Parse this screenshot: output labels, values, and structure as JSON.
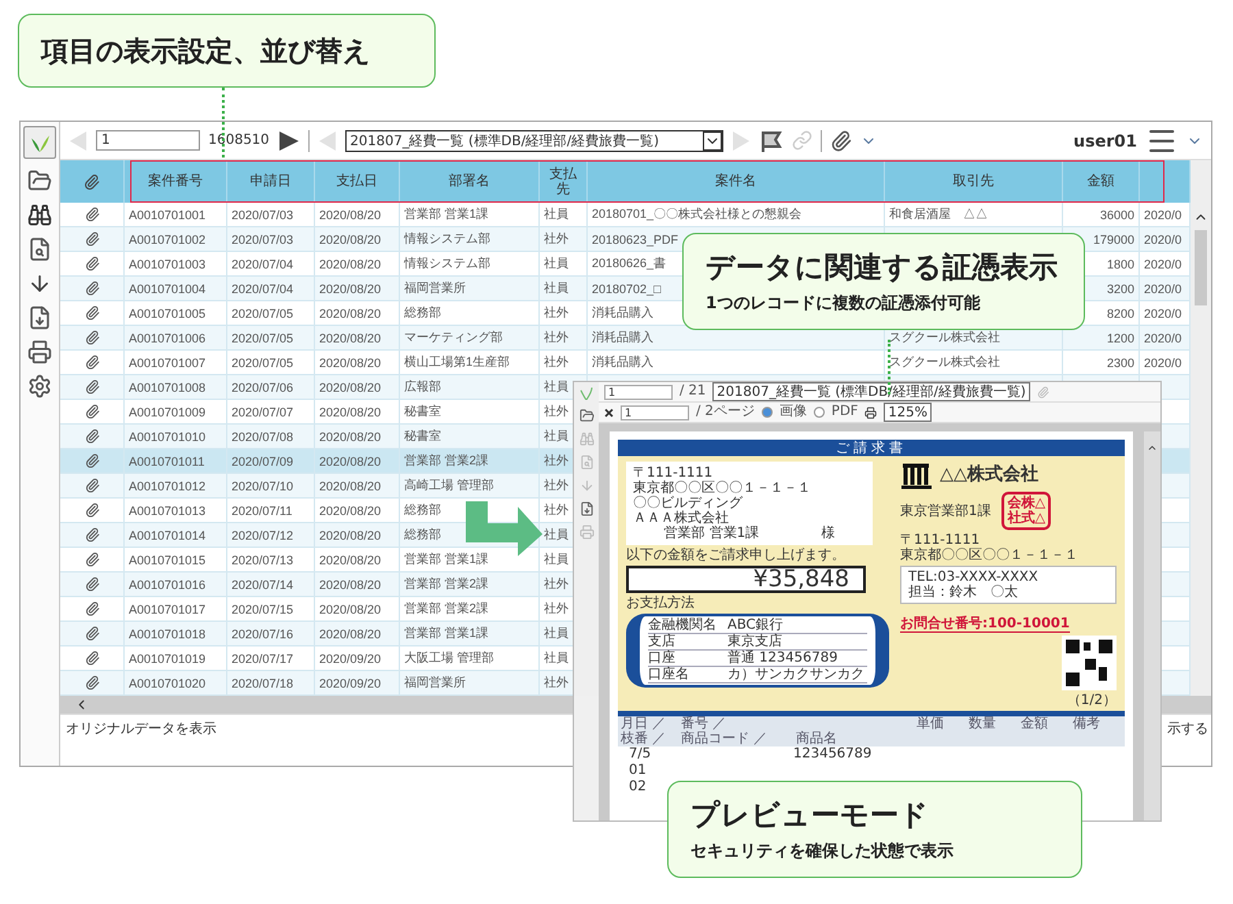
{
  "callouts": [
    {
      "kind": "heading",
      "title": "項目の表示設定、並び替え"
    },
    {
      "kind": "detail",
      "title": "データに関連する証憑表示",
      "subtitle": "1つのレコードに複数の証憑添付可能"
    },
    {
      "kind": "detail",
      "title": "プレビューモード",
      "subtitle": "セキュリティを確保した状態で表示"
    }
  ],
  "toolbar": {
    "page": "1",
    "total": "1608510",
    "view": "201807_経費一覧 (標準DB/経理部/経費旅費一覧)",
    "user": "user01"
  },
  "table": {
    "columns": [
      "案件番号",
      "申請日",
      "支払日",
      "部署名",
      "支払先",
      "案件名",
      "取引先",
      "金額"
    ],
    "rows": [
      {
        "selected": false,
        "number": "A0010701001",
        "applied": "2020/07/03",
        "paid": "2020/08/20",
        "dept": "営業部 営業1課",
        "payee": "社員",
        "title": "20180701_〇〇株式会社様との懇親会",
        "partner": "和食居酒屋　△△",
        "amount": "36000",
        "date": "2020/0"
      },
      {
        "selected": false,
        "number": "A0010701002",
        "applied": "2020/07/03",
        "paid": "2020/08/20",
        "dept": "情報システム部",
        "payee": "社外",
        "title": "20180623_PDF",
        "amount": "179000",
        "date": "2020/0"
      },
      {
        "selected": false,
        "number": "A0010701003",
        "applied": "2020/07/04",
        "paid": "2020/08/20",
        "dept": "情報システム部",
        "payee": "社員",
        "title": "20180626_書",
        "amount": "1800",
        "date": "2020/0"
      },
      {
        "selected": false,
        "number": "A0010701004",
        "applied": "2020/07/04",
        "paid": "2020/08/20",
        "dept": "福岡営業所",
        "payee": "社員",
        "title": "20180702_□",
        "amount": "3200",
        "date": "2020/0"
      },
      {
        "selected": false,
        "number": "A0010701005",
        "applied": "2020/07/05",
        "paid": "2020/08/20",
        "dept": "総務部",
        "payee": "社外",
        "title": "消耗品購入",
        "amount": "8200",
        "date": "2020/0"
      },
      {
        "selected": false,
        "number": "A0010701006",
        "applied": "2020/07/05",
        "paid": "2020/08/20",
        "dept": "マーケティング部",
        "payee": "社外",
        "title": "消耗品購入",
        "partner": "スグクール株式会社",
        "amount": "1200",
        "date": "2020/0"
      },
      {
        "selected": false,
        "number": "A0010701007",
        "applied": "2020/07/05",
        "paid": "2020/08/20",
        "dept": "横山工場第1生産部",
        "payee": "社外",
        "title": "消耗品購入",
        "partner": "スグクール株式会社",
        "amount": "2300",
        "date": "2020/0"
      },
      {
        "selected": false,
        "number": "A0010701008",
        "applied": "2020/07/06",
        "paid": "2020/08/20",
        "dept": "広報部",
        "payee": "社員"
      },
      {
        "selected": false,
        "number": "A0010701009",
        "applied": "2020/07/07",
        "paid": "2020/08/20",
        "dept": "秘書室",
        "payee": "社外"
      },
      {
        "selected": false,
        "number": "A0010701010",
        "applied": "2020/07/08",
        "paid": "2020/08/20",
        "dept": "秘書室",
        "payee": "社員"
      },
      {
        "selected": true,
        "number": "A0010701011",
        "applied": "2020/07/09",
        "paid": "2020/08/20",
        "dept": "営業部 営業2課",
        "payee": "社外"
      },
      {
        "selected": false,
        "number": "A0010701012",
        "applied": "2020/07/10",
        "paid": "2020/08/20",
        "dept": "高崎工場 管理部",
        "payee": "社外"
      },
      {
        "selected": false,
        "number": "A0010701013",
        "applied": "2020/07/11",
        "paid": "2020/08/20",
        "dept": "総務部",
        "payee": "社外"
      },
      {
        "selected": false,
        "number": "A0010701014",
        "applied": "2020/07/12",
        "paid": "2020/08/20",
        "dept": "総務部",
        "payee": "社員"
      },
      {
        "selected": false,
        "number": "A0010701015",
        "applied": "2020/07/13",
        "paid": "2020/08/20",
        "dept": "営業部 営業1課",
        "payee": "社員"
      },
      {
        "selected": false,
        "number": "A0010701016",
        "applied": "2020/07/14",
        "paid": "2020/08/20",
        "dept": "営業部 営業2課",
        "payee": "社外"
      },
      {
        "selected": false,
        "number": "A0010701017",
        "applied": "2020/07/15",
        "paid": "2020/08/20",
        "dept": "営業部 営業2課",
        "payee": "社外"
      },
      {
        "selected": false,
        "number": "A0010701018",
        "applied": "2020/07/16",
        "paid": "2020/08/20",
        "dept": "営業部 営業1課",
        "payee": "社員"
      },
      {
        "selected": false,
        "number": "A0010701019",
        "applied": "2020/07/17",
        "paid": "2020/09/20",
        "dept": "大阪工場 管理部",
        "payee": "社員"
      },
      {
        "selected": false,
        "number": "A0010701020",
        "applied": "2020/07/18",
        "paid": "2020/09/20",
        "dept": "福岡営業所",
        "payee": "社外"
      }
    ]
  },
  "status_bar": {
    "left": "オリジナルデータを表示",
    "right": "示する"
  },
  "preview": {
    "toolbar": {
      "page": "1",
      "total": "/ 21",
      "view": "201807_経費一覧 (標準DB/経理部/経費旅費一覧)"
    },
    "viewer": {
      "page": "1",
      "pages": "/ 2ページ",
      "modes": [
        {
          "label": "画像",
          "selected": true
        },
        {
          "label": "PDF",
          "selected": false
        }
      ],
      "zoom": "125%"
    },
    "invoice": {
      "title": "ご請求書",
      "recipient": [
        "〒111-1111",
        "東京都〇〇区〇〇１－１－１",
        "〇〇ビルディング",
        "ＡＡＡ株式会社"
      ],
      "recipient_dept": "営業部 営業1課",
      "honorific": "様",
      "issuer": "△△株式会社",
      "issuer_dept": "東京営業部1課",
      "stamp": [
        "会株△",
        "社式△"
      ],
      "issuer_address": [
        "〒111-1111",
        "東京都〇〇区〇〇１－１－１"
      ],
      "contact": [
        "TEL:03-XXXX-XXXX",
        "担当：鈴木　〇太"
      ],
      "inquiry": "お問合せ番号:100-10001",
      "lead": "以下の金額をご請求申し上げます。",
      "amount": "¥35,848",
      "payment_label": "お支払方法",
      "bank": [
        {
          "label": "金融機関名",
          "value": "ABC銀行"
        },
        {
          "label": "支店",
          "value": "東京支店"
        },
        {
          "label": "口座",
          "value": "普通 123456789"
        },
        {
          "label": "口座名",
          "value": "カ）サンカクサンカク"
        }
      ],
      "page": "（1/2）",
      "items_header": [
        "月日 ／",
        "番号 ／",
        "単価",
        "数量",
        "金額",
        "備考",
        "枝番 ／",
        "商品コード ／",
        "商品名"
      ],
      "items": [
        {
          "date": "7/5",
          "name": "123456789"
        },
        {
          "date": "01"
        },
        {
          "date": "02"
        }
      ]
    }
  }
}
